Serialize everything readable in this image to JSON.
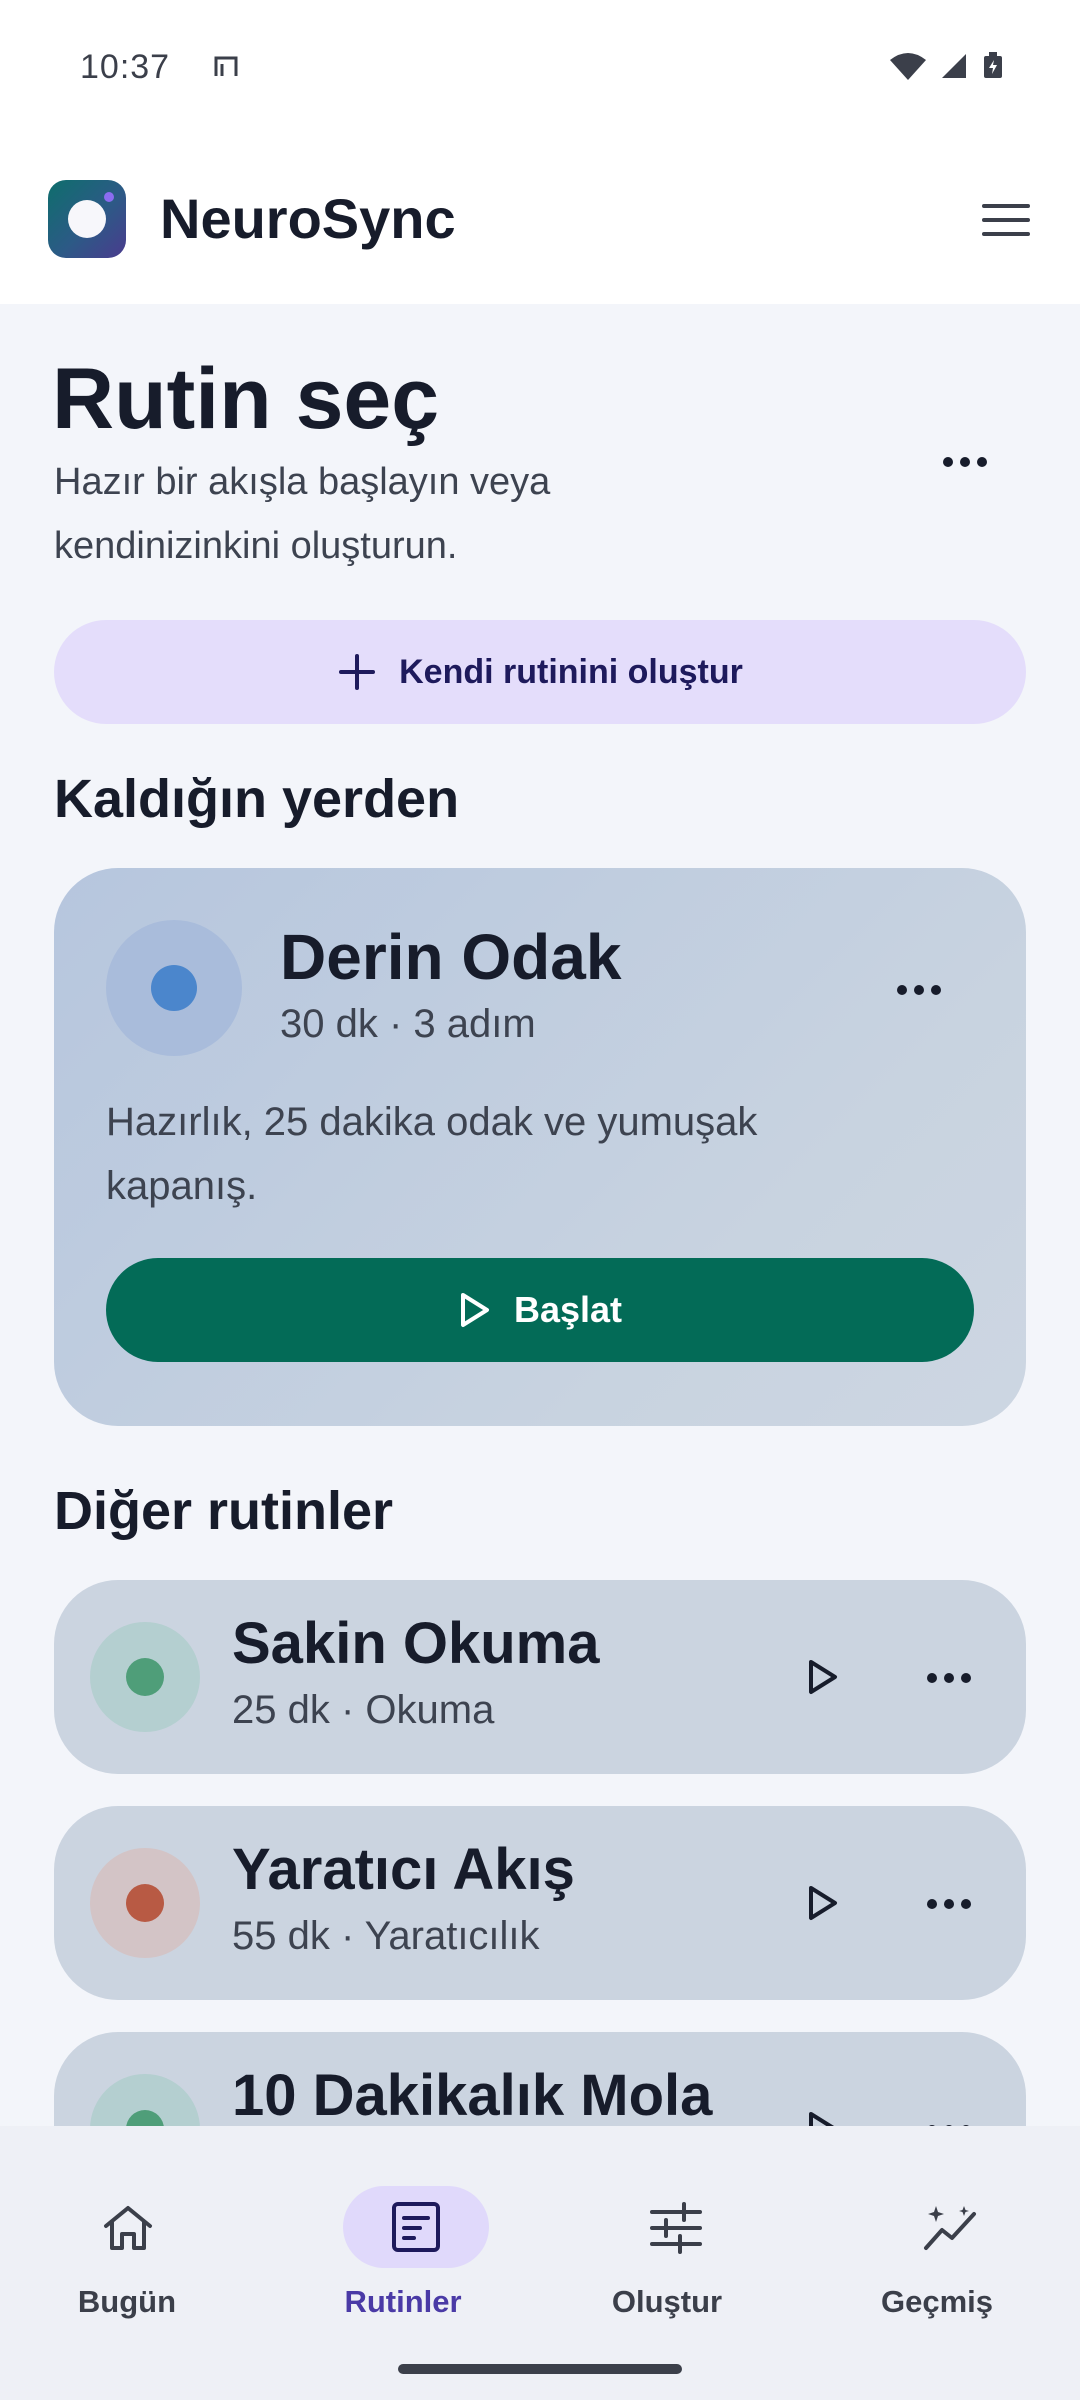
{
  "status_bar": {
    "time": "10:37"
  },
  "app": {
    "name": "NeuroSync"
  },
  "page": {
    "title": "Rutin seç",
    "subtitle": "Hazır bir akışla başlayın veya kendinizinkini oluşturun.",
    "create_label": "Kendi rutinini oluştur"
  },
  "continue_section": {
    "title": "Kaldığın yerden",
    "routine": {
      "name": "Derin Odak",
      "meta": "30 dk · 3 adım",
      "description": "Hazırlık, 25 dakika odak ve yumuşak kapanış.",
      "start_label": "Başlat",
      "color": "#4b86cc"
    }
  },
  "other_section": {
    "title": "Diğer rutinler",
    "routines": [
      {
        "name": "Sakin Okuma",
        "meta": "25 dk · Okuma",
        "color": "#4f9e79",
        "bg": "#b4cfd0"
      },
      {
        "name": "Yaratıcı Akış",
        "meta": "55 dk · Yaratıcılık",
        "color": "#b85a44",
        "bg": "#d3c4c6"
      },
      {
        "name": "10 Dakikalık Mola",
        "meta": "",
        "color": "#4f9e79",
        "bg": "#b4cfd0"
      }
    ]
  },
  "bottom_nav": {
    "items": [
      {
        "label": "Bugün",
        "icon": "home-icon"
      },
      {
        "label": "Rutinler",
        "icon": "routines-icon",
        "active": true
      },
      {
        "label": "Oluştur",
        "icon": "sliders-icon"
      },
      {
        "label": "Geçmiş",
        "icon": "sparkle-chart-icon"
      }
    ]
  }
}
